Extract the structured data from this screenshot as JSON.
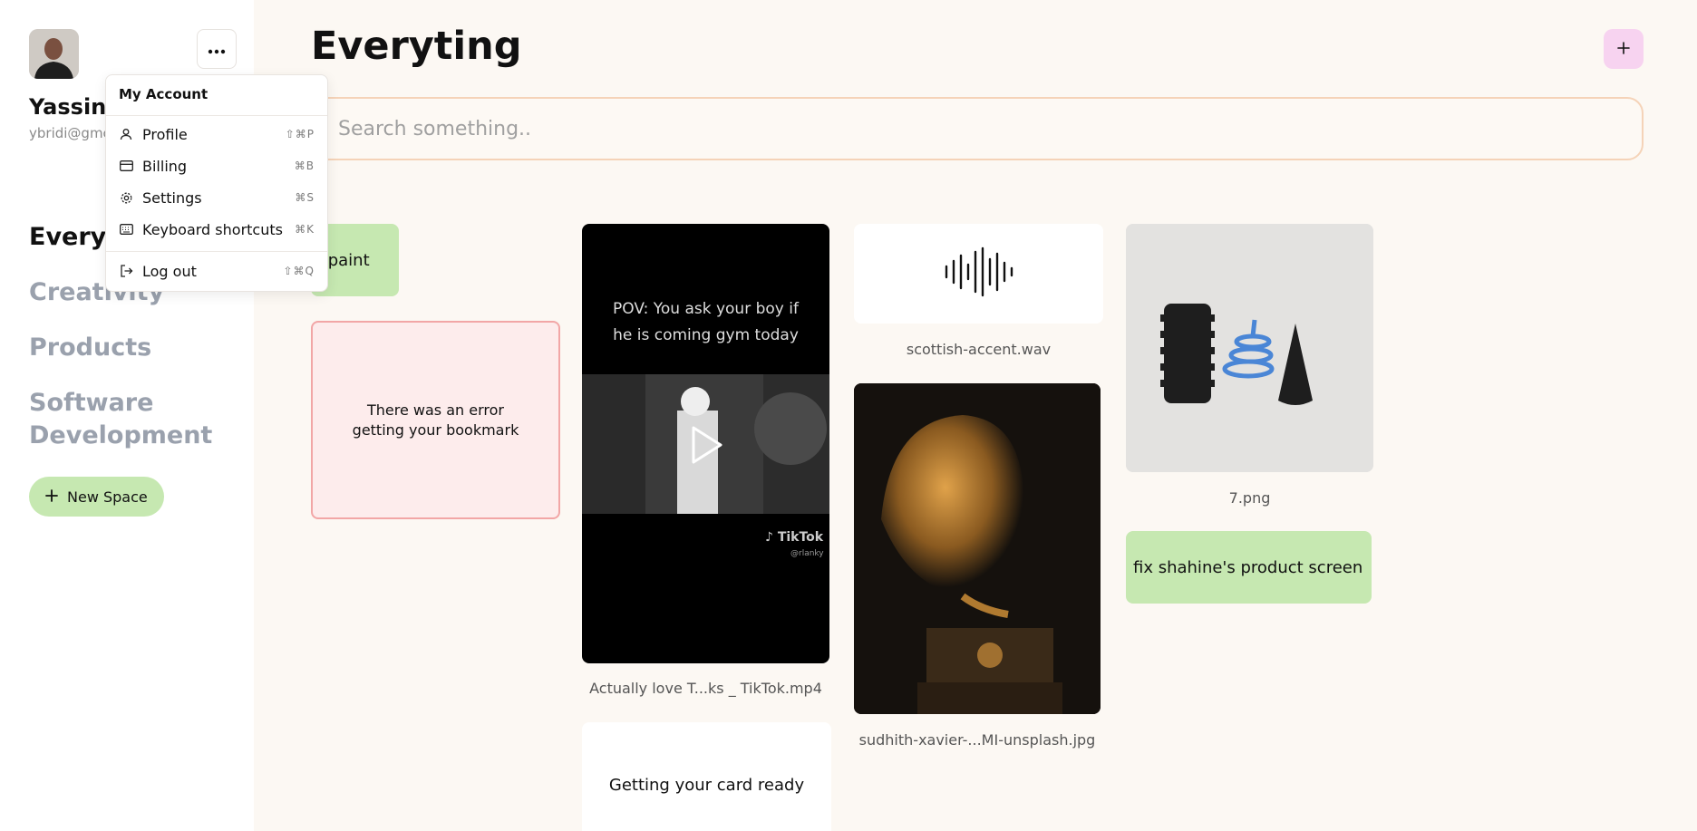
{
  "user": {
    "name": "Yassine",
    "email": "ybridi@gmc"
  },
  "nav": {
    "items": [
      {
        "label": "Everyt",
        "active": true
      },
      {
        "label": "Creativity",
        "active": false
      },
      {
        "label": "Products",
        "active": false
      },
      {
        "label": "Software Development",
        "active": false
      }
    ],
    "new_space_label": "New Space"
  },
  "menu": {
    "title": "My Account",
    "items": [
      {
        "label": "Profile",
        "shortcut": "⇧⌘P",
        "icon": "user-icon"
      },
      {
        "label": "Billing",
        "shortcut": "⌘B",
        "icon": "credit-card-icon"
      },
      {
        "label": "Settings",
        "shortcut": "⌘S",
        "icon": "gear-icon"
      },
      {
        "label": "Keyboard shortcuts",
        "shortcut": "⌘K",
        "icon": "keyboard-icon"
      },
      {
        "label": "Log out",
        "shortcut": "⇧⌘Q",
        "icon": "logout-icon"
      }
    ]
  },
  "main": {
    "title": "Everyting",
    "search_placeholder": "Search something..",
    "cards": {
      "oil_paint": "il paint",
      "error": "There was an error getting your bookmark",
      "tiktok_text": "POV: You ask your boy if he is coming gym today",
      "tiktok_brand": "TikTok",
      "tiktok_handle": "@rlanky",
      "tiktok_caption": "Actually love T...ks _ TikTok.mp4",
      "getting_ready": "Getting your card ready",
      "audio_caption": "scottish-accent.wav",
      "photo_caption": "sudhith-xavier-...MI-unsplash.jpg",
      "png_caption": "7.png",
      "note_fix": "fix shahine's product screen"
    }
  },
  "colors": {
    "background": "#fcf8f3",
    "note_green": "#c6e8b1",
    "add_button": "#f7d3f0",
    "error_border": "#f2a6a6",
    "search_border": "#f5d3b8"
  }
}
